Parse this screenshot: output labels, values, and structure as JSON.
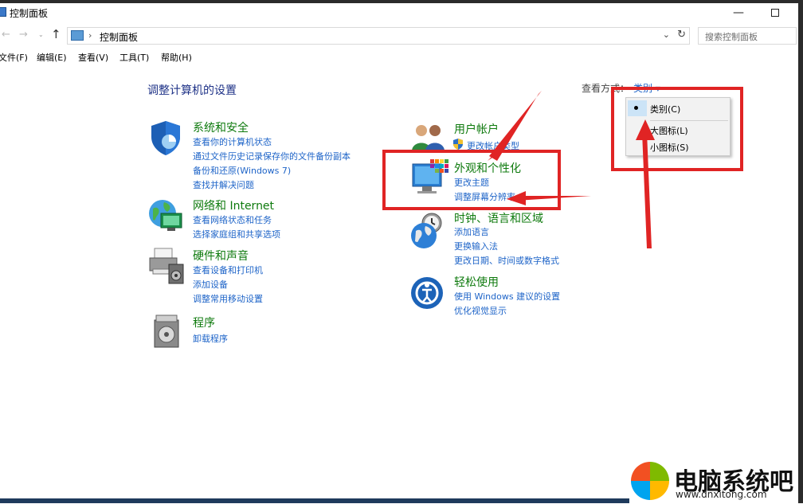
{
  "window": {
    "title": "控制面板",
    "minimize": "—"
  },
  "nav": {
    "back": "←",
    "forward": "→",
    "recent": "⌄",
    "up": "↑",
    "breadcrumb_sep": "›",
    "address": "控制面板",
    "dropdown": "⌄",
    "refresh": "↻",
    "search_placeholder": "搜索控制面板"
  },
  "menu": [
    "文件(F)",
    "编辑(E)",
    "查看(V)",
    "工具(T)",
    "帮助(H)"
  ],
  "heading": "调整计算机的设置",
  "view_by": {
    "label": "查看方式：",
    "value": "类别 ▾"
  },
  "dropdown_menu": {
    "options": [
      "类别(C)",
      "大图标(L)",
      "小图标(S)"
    ],
    "selected": "类别(C)"
  },
  "categories": {
    "system": {
      "title": "系统和安全",
      "links": [
        "查看你的计算机状态",
        "通过文件历史记录保存你的文件备份副本",
        "备份和还原(Windows 7)",
        "查找并解决问题"
      ]
    },
    "network": {
      "title": "网络和 Internet",
      "links": [
        "查看网络状态和任务",
        "选择家庭组和共享选项"
      ]
    },
    "hardware": {
      "title": "硬件和声音",
      "links": [
        "查看设备和打印机",
        "添加设备",
        "调整常用移动设置"
      ]
    },
    "programs": {
      "title": "程序",
      "links": [
        "卸载程序"
      ]
    },
    "users": {
      "title": "用户帐户",
      "links": [
        "更改帐户类型"
      ]
    },
    "appearance": {
      "title": "外观和个性化",
      "links": [
        "更改主题",
        "调整屏幕分辨率"
      ]
    },
    "clock": {
      "title": "时钟、语言和区域",
      "links": [
        "添加语言",
        "更换输入法",
        "更改日期、时间或数字格式"
      ]
    },
    "ease": {
      "title": "轻松使用",
      "links": [
        "使用 Windows 建议的设置",
        "优化视觉显示"
      ]
    }
  },
  "watermark": {
    "text": "电脑系统吧",
    "url": "www.dnxitong.com"
  },
  "colors": {
    "accent_red": "#e02424",
    "link_blue": "#1e64c8",
    "category_green": "#0e7a0d"
  }
}
